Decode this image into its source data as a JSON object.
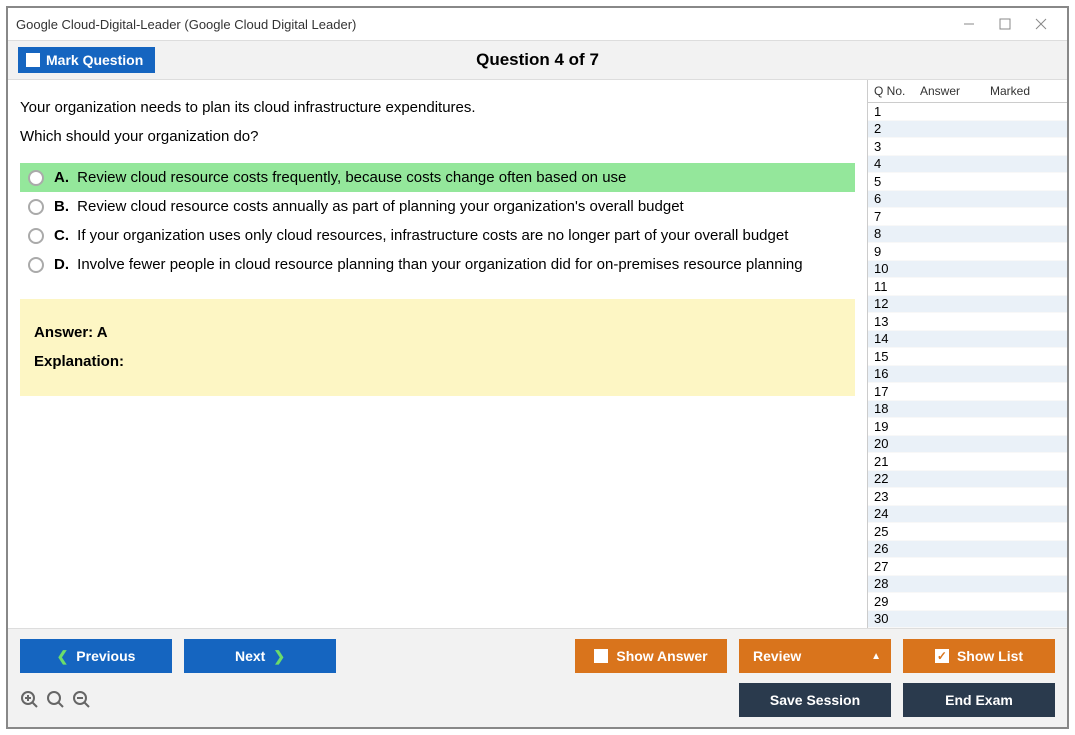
{
  "window": {
    "title": "Google Cloud-Digital-Leader (Google Cloud Digital Leader)"
  },
  "header": {
    "mark_button": "Mark Question",
    "title": "Question 4 of 7"
  },
  "question": {
    "line1": "Your organization needs to plan its cloud infrastructure expenditures.",
    "line2": "Which should your organization do?",
    "options": [
      {
        "letter": "A.",
        "text": "Review cloud resource costs frequently, because costs change often based on use",
        "correct": true
      },
      {
        "letter": "B.",
        "text": "Review cloud resource costs annually as part of planning your organization's overall budget",
        "correct": false
      },
      {
        "letter": "C.",
        "text": "If your organization uses only cloud resources, infrastructure costs are no longer part of your overall budget",
        "correct": false
      },
      {
        "letter": "D.",
        "text": "Involve fewer people in cloud resource planning than your organization did for on-premises resource planning",
        "correct": false
      }
    ],
    "answer_label": "Answer: ",
    "answer_value": "A",
    "explanation_label": "Explanation:"
  },
  "sidebar": {
    "headers": {
      "qno": "Q No.",
      "answer": "Answer",
      "marked": "Marked"
    },
    "total_rows": 30
  },
  "footer": {
    "previous": "Previous",
    "next": "Next",
    "show_answer": "Show Answer",
    "review": "Review",
    "show_list": "Show List",
    "save_session": "Save Session",
    "end_exam": "End Exam"
  }
}
